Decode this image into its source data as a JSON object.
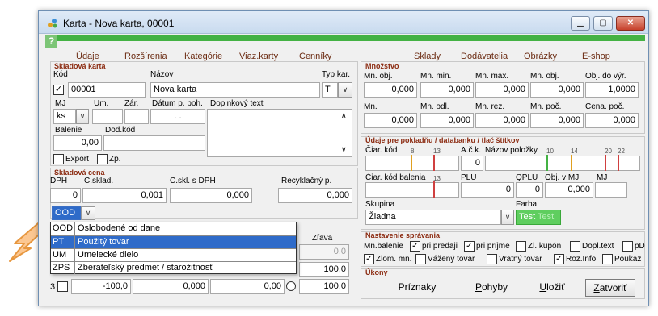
{
  "window": {
    "title": "Karta - Nova karta, 00001",
    "help_label": "?"
  },
  "tabs": [
    "Údaje",
    "Rozšírenia",
    "Kategórie",
    "Viaz.karty",
    "Cenníky",
    "Sklady",
    "Dodávatelia",
    "Obrázky",
    "E-shop"
  ],
  "skladova_karta": {
    "title": "Skladová karta",
    "kod_label": "Kód",
    "kod_value": "00001",
    "nazov_label": "Názov",
    "nazov_value": "Nova karta",
    "typ_label": "Typ kar.",
    "typ_value": "T",
    "mj_label": "MJ",
    "mj_value": "ks",
    "um_label": "Um.",
    "zar_label": "Zár.",
    "datum_label": "Dátum p. poh.",
    "datum_value": ". .",
    "doplnkovy_label": "Doplnkový text",
    "balenie_label": "Balenie",
    "balenie_value": "0,00",
    "dodkod_label": "Dod.kód",
    "export_label": "Export",
    "zp_label": "Zp."
  },
  "skladova_cena": {
    "title": "Skladová cena",
    "dph_label": "DPH",
    "dph_value": "0",
    "csklad_label": "C.sklad.",
    "csklad_value": "0,001",
    "cskl_dph_label": "C.skl. s DPH",
    "cskl_dph_value": "0,000",
    "recyk_label": "Recyklačný p.",
    "recyk_value": "0,000",
    "select_value": "OOD"
  },
  "dropdown_options": [
    {
      "code": "OOD",
      "desc": "Oslobodené od dane"
    },
    {
      "code": "PT",
      "desc": "Použitý tovar"
    },
    {
      "code": "UM",
      "desc": "Umelecké dielo"
    },
    {
      "code": "ZPS",
      "desc": "Zberateľský predmet / starožitnosť"
    }
  ],
  "zlava": {
    "label": "Zľava",
    "row1_value": "0,0",
    "row2_value": "100,0"
  },
  "price_row3": {
    "index": "3",
    "v1": "-100,0",
    "v2": "0,000",
    "v3": "0,00",
    "v4": "100,0"
  },
  "mnozstvo": {
    "title": "Množstvo",
    "labels1": [
      "Mn. obj.",
      "Mn. min.",
      "Mn. max.",
      "Mn. obj.",
      "Obj. do výr."
    ],
    "values1": [
      "0,000",
      "0,000",
      "0,000",
      "0,000",
      "1,0000"
    ],
    "labels2": [
      "Mn.",
      "Mn. odl.",
      "Mn. rez.",
      "Mn. poč.",
      "Cena. poč."
    ],
    "values2": [
      "0,000",
      "0,000",
      "0,000",
      "0,000",
      "0,000"
    ]
  },
  "pokladna": {
    "title": "Údaje pre pokladňu / databanku / tlač štítkov",
    "ciar_label": "Čiar. kód",
    "ack_label": "A.č.k.",
    "ack_value": "0",
    "nazov_pol_label": "Názov položky",
    "ciar_bal_label": "Čiar. kód balenia",
    "plu_label": "PLU",
    "plu_value": "0",
    "qplu_label": "QPLU",
    "qplu_value": "0",
    "obj_mj_label": "Obj. v MJ",
    "obj_mj_value": "0,000",
    "mj_label": "MJ",
    "marks_ciar": [
      "8",
      "13"
    ],
    "marks_nazov": [
      "10",
      "14",
      "20",
      "22"
    ],
    "marks_bal": [
      "13"
    ],
    "skupina_label": "Skupina",
    "skupina_value": "Žiadna",
    "farba_label": "Farba",
    "farba_sample": "Test",
    "farba_sample2": "Test"
  },
  "nastavenie": {
    "title": "Nastavenie správania",
    "row1": [
      "Mn.balenie",
      "pri predaji",
      "pri príjme",
      "Zl. kupón",
      "Dopl.text",
      "pD"
    ],
    "row2": [
      "Zlom. mn.",
      "Vážený tovar",
      "Vratný tovar",
      "Roz.Info",
      "Poukaz"
    ]
  },
  "ukony": {
    "title": "Úkony",
    "priznaky": "Príznaky",
    "pohyby_first": "P",
    "pohyby_rest": "ohyby",
    "ulozit_first": "U",
    "ulozit_rest": "ložiť",
    "zatvorit_first": "Z",
    "zatvorit_rest": "atvoriť"
  },
  "colors": {
    "accent_green": "#44b244",
    "selection_blue": "#2f6bc9",
    "label_brown": "#8b2a10",
    "farba_green": "#5fce5f"
  }
}
